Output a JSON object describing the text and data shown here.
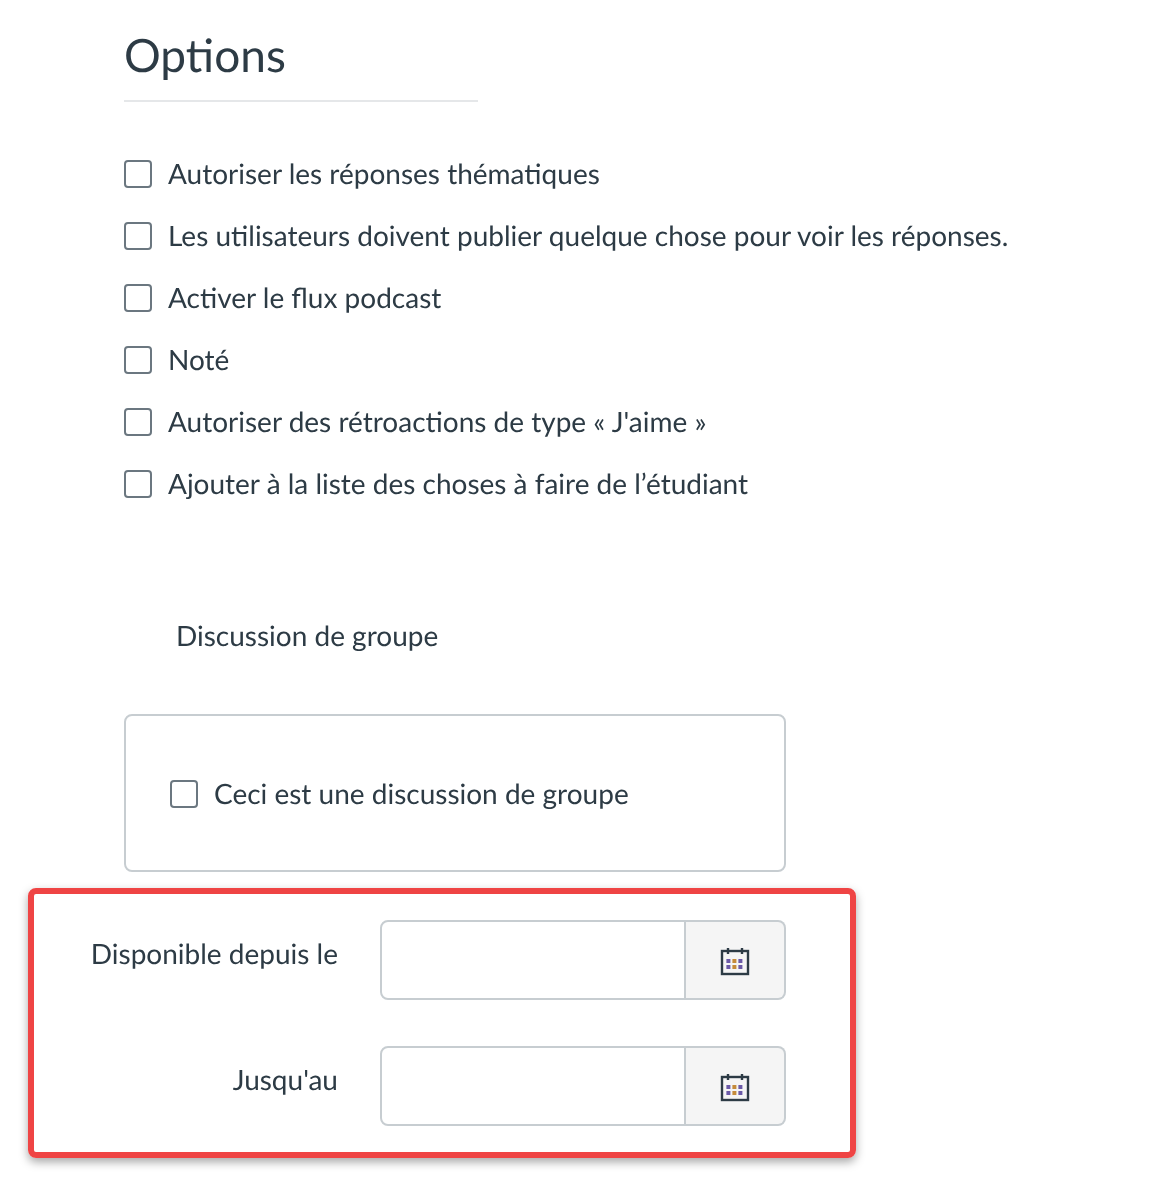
{
  "heading": "Options",
  "options": [
    {
      "label": "Autoriser les réponses thématiques",
      "checked": false
    },
    {
      "label": "Les utilisateurs doivent publier quelque chose pour voir les réponses.",
      "checked": false
    },
    {
      "label": "Activer le flux podcast",
      "checked": false
    },
    {
      "label": "Noté",
      "checked": false
    },
    {
      "label": "Autoriser des rétroactions de type « J'aime »",
      "checked": false
    },
    {
      "label": "Ajouter à la liste des choses à faire de l’étudiant",
      "checked": false
    }
  ],
  "group_discussion": {
    "title": "Discussion de groupe",
    "option": {
      "label": "Ceci est une discussion de groupe",
      "checked": false
    }
  },
  "dates": [
    {
      "label": "Disponible depuis le"
    },
    {
      "label": "Jusqu'au"
    }
  ]
}
